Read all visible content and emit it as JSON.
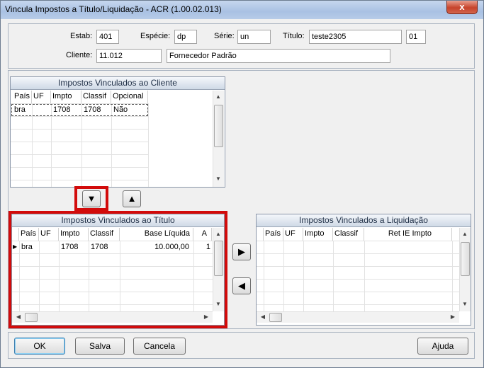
{
  "window": {
    "title": "Vincula Impostos a Título/Liquidação - ACR (1.00.02.013)",
    "close_glyph": "x"
  },
  "header": {
    "estab_label": "Estab:",
    "estab_value": "401",
    "especie_label": "Espécie:",
    "especie_value": "dp",
    "serie_label": "Série:",
    "serie_value": "un",
    "titulo_label": "Título:",
    "titulo_value": "teste2305",
    "parcela_value": "01",
    "cliente_label": "Cliente:",
    "cliente_code": "11.012",
    "cliente_name": "Fornecedor Padrão"
  },
  "grid_cliente": {
    "title": "Impostos Vinculados ao Cliente",
    "columns": [
      "País",
      "UF",
      "Impto",
      "Classif",
      "Opcional"
    ],
    "rows": [
      [
        "bra",
        "",
        "1708",
        "1708",
        "Não"
      ]
    ]
  },
  "grid_titulo": {
    "title": "Impostos Vinculados ao Título",
    "columns": [
      "País",
      "UF",
      "Impto",
      "Classif",
      "Base Líquida",
      "A"
    ],
    "rows": [
      [
        "bra",
        "",
        "1708",
        "1708",
        "10.000,00",
        "1"
      ]
    ]
  },
  "grid_liquidacao": {
    "title": "Impostos Vinculados a Liquidação",
    "columns": [
      "País",
      "UF",
      "Impto",
      "Classif",
      "Ret IE Impto"
    ],
    "rows": []
  },
  "move_buttons": {
    "down": "▼",
    "up": "▲",
    "right": "▶",
    "left": "◀"
  },
  "footer": {
    "ok": "OK",
    "salva": "Salva",
    "cancela": "Cancela",
    "ajuda": "Ajuda"
  },
  "colors": {
    "highlight": "#d20b0b",
    "title_bar": "#a9c1e3"
  }
}
